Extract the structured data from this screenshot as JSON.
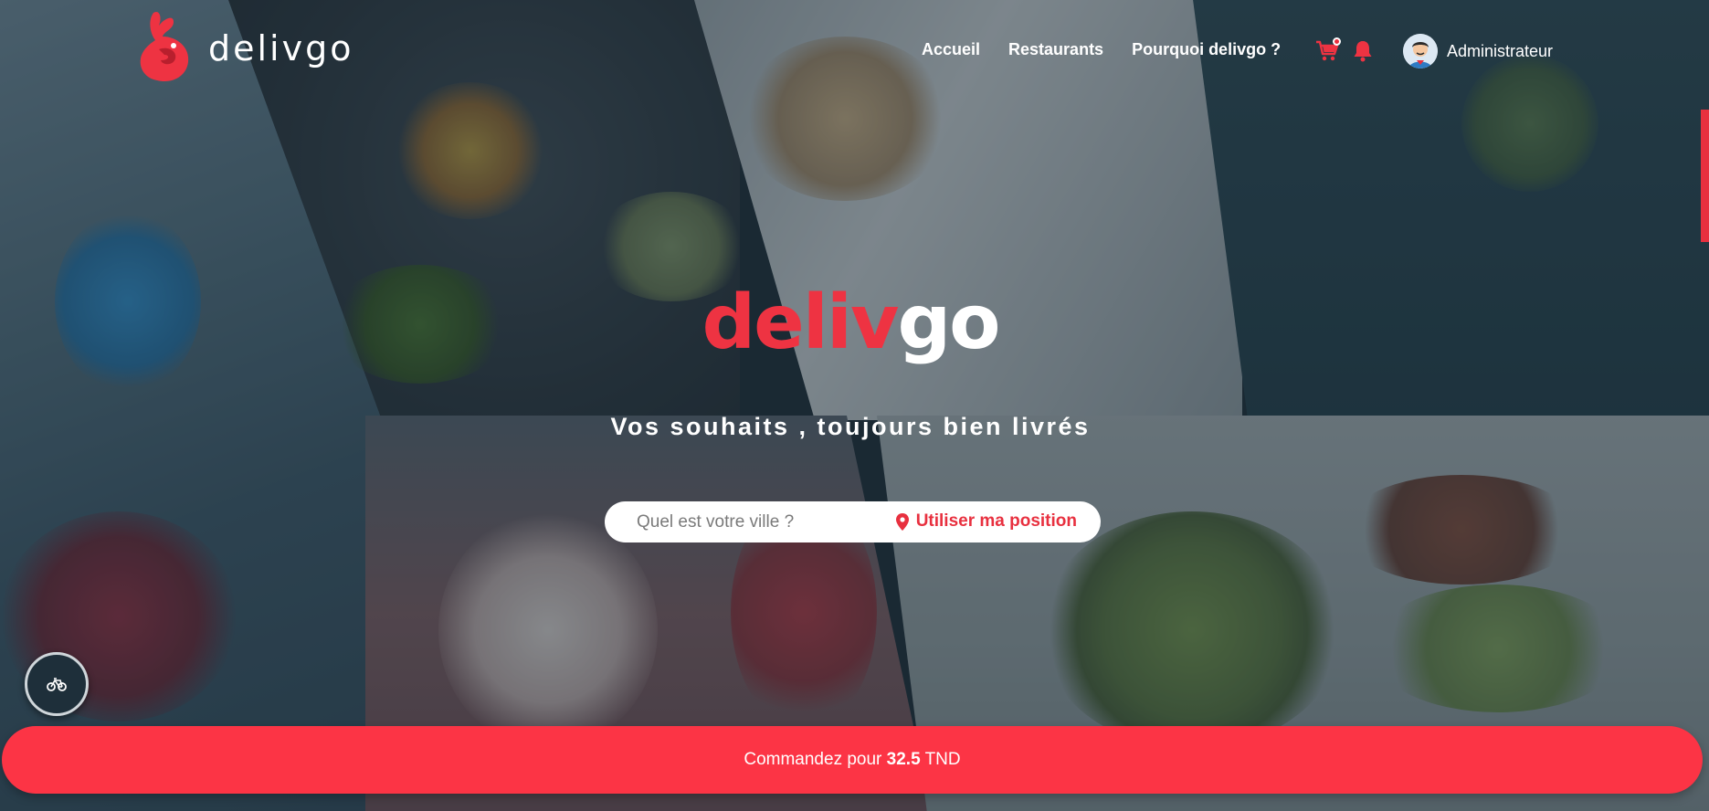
{
  "brand": {
    "logo_text": "delivgo",
    "hero_title_red": "deliv",
    "hero_title_white": "go",
    "tagline": "Vos souhaits , toujours bien livrés"
  },
  "nav": {
    "links": [
      "Accueil",
      "Restaurants",
      "Pourquoi delivgo ?"
    ],
    "cart_icon": "cart-icon",
    "notification_icon": "bell-icon",
    "user_name": "Administrateur"
  },
  "search": {
    "placeholder": "Quel est votre ville ?",
    "value": "",
    "geo_button_label": "Utiliser ma position",
    "geo_icon": "map-pin-icon"
  },
  "order_bar": {
    "prefix": "Commandez pour ",
    "amount": "32.5",
    "currency": " TND"
  },
  "fab": {
    "icon": "bicycle-icon"
  },
  "colors": {
    "accent": "#fc3445",
    "brand_red": "#ee3342",
    "white": "#ffffff",
    "overlay": "#182834"
  }
}
